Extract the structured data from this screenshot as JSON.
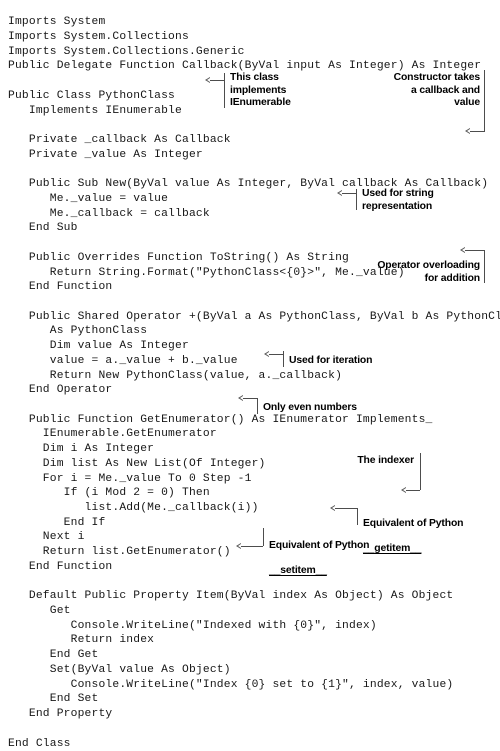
{
  "document": {
    "language": "Visual Basic .NET",
    "kind": "annotated-code-listing"
  },
  "code": {
    "lines": [
      "Imports System",
      "Imports System.Collections",
      "Imports System.Collections.Generic",
      "Public Delegate Function Callback(ByVal input As Integer) As Integer",
      "",
      "Public Class PythonClass",
      "   Implements IEnumerable",
      "",
      "   Private _callback As Callback",
      "   Private _value As Integer",
      "",
      "   Public Sub New(ByVal value As Integer, ByVal callback As Callback)",
      "      Me._value = value",
      "      Me._callback = callback",
      "   End Sub",
      "",
      "   Public Overrides Function ToString() As String",
      "      Return String.Format(\"PythonClass<{0}>\", Me._value)",
      "   End Function",
      "",
      "   Public Shared Operator +(ByVal a As PythonClass, ByVal b As PythonClass)_",
      "      As PythonClass",
      "      Dim value As Integer",
      "      value = a._value + b._value",
      "      Return New PythonClass(value, a._callback)",
      "   End Operator",
      "",
      "   Public Function GetEnumerator() As IEnumerator Implements_",
      "     IEnumerable.GetEnumerator",
      "     Dim i As Integer",
      "     Dim list As New List(Of Integer)",
      "     For i = Me._value To 0 Step -1",
      "        If (i Mod 2 = 0) Then",
      "           list.Add(Me._callback(i))",
      "        End If",
      "     Next i",
      "     Return list.GetEnumerator()",
      "   End Function",
      "",
      "   Default Public Property Item(ByVal index As Object) As Object",
      "      Get",
      "         Console.WriteLine(\"Indexed with {0}\", index)",
      "         Return index",
      "      End Get",
      "      Set(ByVal value As Object)",
      "         Console.WriteLine(\"Index {0} set to {1}\", index, value)",
      "      End Set",
      "   End Property",
      "",
      "End Class"
    ]
  },
  "annotations": [
    {
      "id": "implements-ienumerable",
      "text": "This class\nimplements\nIEnumerable",
      "align": "left"
    },
    {
      "id": "constructor-takes",
      "text": "Constructor takes\na callback and\nvalue",
      "align": "right"
    },
    {
      "id": "string-representation",
      "text": "Used for string\nrepresentation",
      "align": "left"
    },
    {
      "id": "operator-overloading",
      "text": "Operator overloading\nfor addition",
      "align": "right"
    },
    {
      "id": "used-for-iteration",
      "text": "Used for iteration",
      "align": "left"
    },
    {
      "id": "only-even-numbers",
      "text": "Only even numbers",
      "align": "left"
    },
    {
      "id": "the-indexer",
      "text": "The indexer",
      "align": "right"
    },
    {
      "id": "equivalent-getitem",
      "text": "Equivalent of Python\n__getitem__",
      "align": "left"
    },
    {
      "id": "equivalent-setitem",
      "text": "Equivalent of Python\n__setitem__",
      "align": "left"
    }
  ],
  "colors": {
    "background": "#ffffff",
    "code_text": "#161616",
    "annotation_text": "#000000",
    "leader_line": "#4d4d4d"
  }
}
